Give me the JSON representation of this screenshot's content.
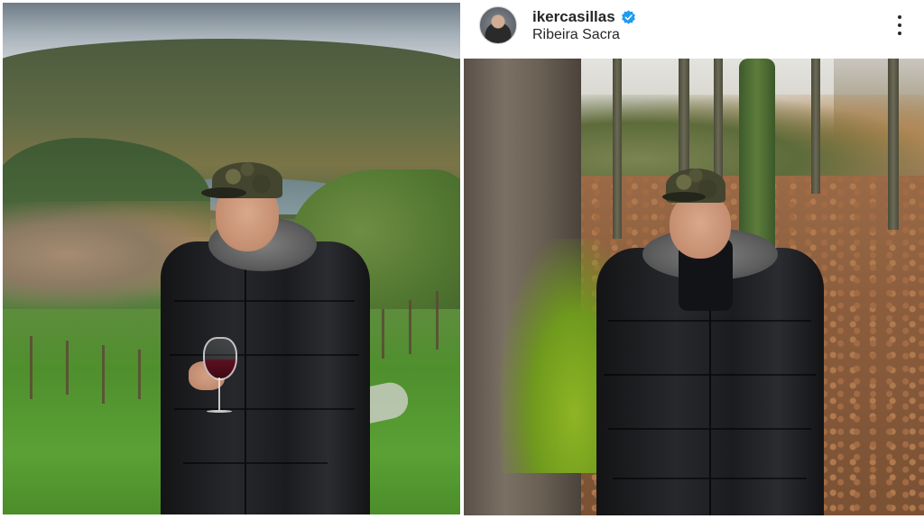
{
  "post": {
    "username": "ikercasillas",
    "location": "Ribeira Sacra",
    "verified_icon": "verified-badge-icon",
    "more_icon": "more-options-icon",
    "avatar_icon": "profile-avatar"
  },
  "colors": {
    "verified_blue": "#1f9bf0",
    "text": "#262626",
    "background": "#ffffff"
  },
  "images": {
    "left_photo": "man-in-black-coat-holding-wine-glass-vineyard",
    "right_photo": "man-in-black-coat-forest-autumn-leaves"
  }
}
